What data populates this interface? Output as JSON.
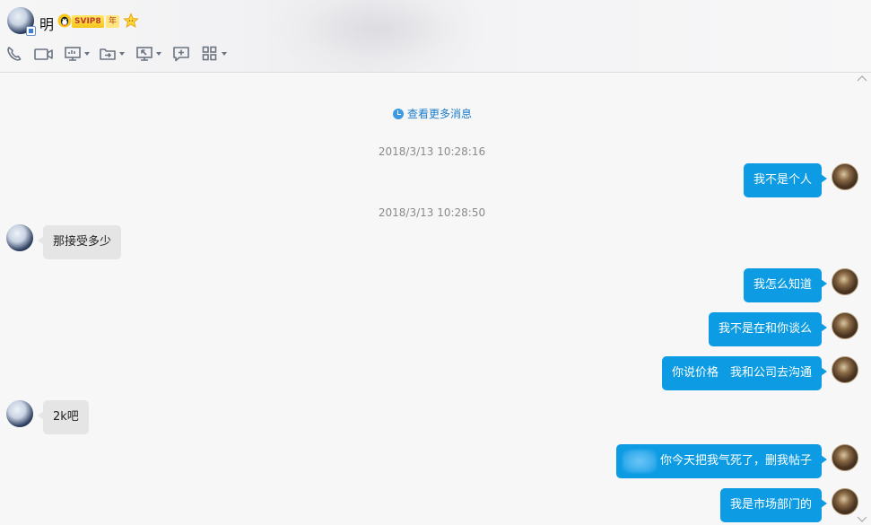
{
  "header": {
    "contact_name": "明",
    "svip_label": "SVIP8",
    "year_label": "年"
  },
  "toolbar": {
    "items": [
      {
        "icon": "phone-icon"
      },
      {
        "icon": "video-icon"
      },
      {
        "icon": "screen-share-icon"
      },
      {
        "icon": "file-transfer-icon"
      },
      {
        "icon": "remote-desktop-icon"
      },
      {
        "icon": "add-chat-icon"
      },
      {
        "icon": "apps-icon"
      }
    ]
  },
  "chat": {
    "more_messages": "查看更多消息",
    "timestamps": [
      "2018/3/13 10:28:16",
      "2018/3/13 10:28:50"
    ],
    "messages": [
      {
        "from": "me",
        "text": "我不是个人"
      },
      {
        "from": "other",
        "text": "那接受多少"
      },
      {
        "from": "me",
        "text": "我怎么知道"
      },
      {
        "from": "me",
        "text": "我不是在和你谈么"
      },
      {
        "from": "me",
        "text": "你说价格　我和公司去沟通"
      },
      {
        "from": "other",
        "text": "2k吧"
      },
      {
        "from": "me",
        "text": "你今天把我气死了，删我帖子"
      },
      {
        "from": "me",
        "text": "我是市场部门的"
      }
    ]
  },
  "colors": {
    "my_bubble": "#0d9ce3",
    "other_bubble": "#e5e5e5",
    "link": "#1c7cc7"
  }
}
